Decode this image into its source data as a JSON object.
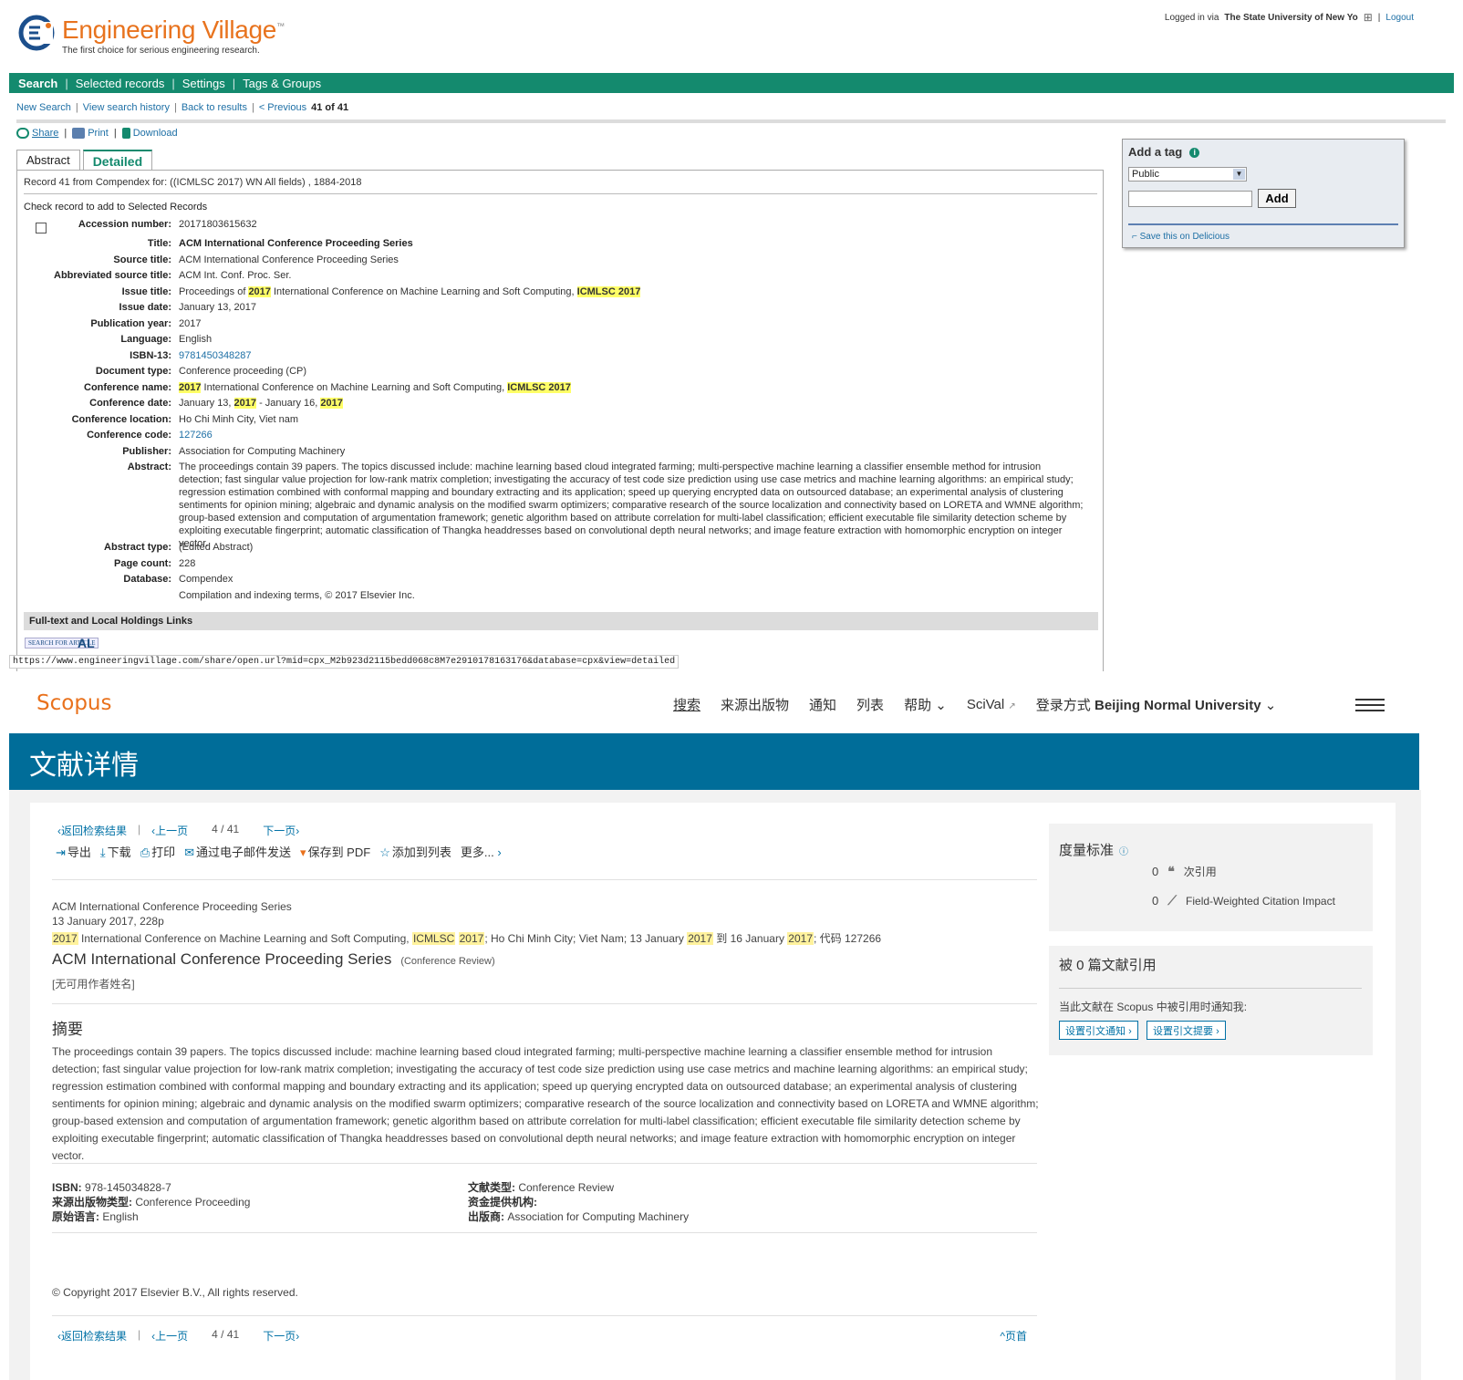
{
  "ev": {
    "logo_name": "Engineering Village",
    "logo_tm": "™",
    "tagline": "The first choice for serious engineering research.",
    "login_prefix": "Logged in via",
    "login_institution": "The State University of New Yo",
    "logout": "Logout",
    "nav": [
      "Search",
      "Selected records",
      "Settings",
      "Tags & Groups"
    ],
    "subnav": {
      "new_search": "New Search",
      "history": "View search history",
      "back": "Back to results",
      "previous": "< Previous",
      "pos": "41 of 41"
    },
    "tools": {
      "share": "Share",
      "print": "Print",
      "download": "Download"
    },
    "tabs": [
      "Abstract",
      "Detailed"
    ],
    "record_line": "Record 41 from Compendex for: ((ICMLSC 2017) WN All fields) , 1884-2018",
    "check_label": "Check record to add to Selected Records",
    "fields": {
      "accession": {
        "k": "Accession number:",
        "v": "20171803615632"
      },
      "title": {
        "k": "Title:",
        "v": "ACM International Conference Proceeding Series"
      },
      "source": {
        "k": "Source title:",
        "v": "ACM International Conference Proceeding Series"
      },
      "abbr": {
        "k": "Abbreviated source title:",
        "v": "ACM Int. Conf. Proc. Ser."
      },
      "issue_title": {
        "k": "Issue title:",
        "a": "Proceedings of ",
        "b": "2017",
        "c": " International Conference on Machine Learning and Soft Computing, ",
        "d": "ICMLSC 2017"
      },
      "issue_date": {
        "k": "Issue date:",
        "v": "January 13, 2017"
      },
      "pub_year": {
        "k": "Publication year:",
        "v": "2017"
      },
      "language": {
        "k": "Language:",
        "v": "English"
      },
      "isbn": {
        "k": "ISBN-13:",
        "v": "9781450348287"
      },
      "doc_type": {
        "k": "Document type:",
        "v": "Conference proceeding (CP)"
      },
      "conf_name": {
        "k": "Conference name:",
        "a": "2017",
        "b": " International Conference on Machine Learning and Soft Computing, ",
        "c": "ICMLSC 2017"
      },
      "conf_date": {
        "k": "Conference date:",
        "a": "January 13, ",
        "b": "2017",
        "c": " - January 16, ",
        "d": "2017"
      },
      "conf_loc": {
        "k": "Conference location:",
        "v": "Ho Chi Minh City, Viet nam"
      },
      "conf_code": {
        "k": "Conference code:",
        "v": "127266"
      },
      "publisher": {
        "k": "Publisher:",
        "v": "Association for Computing Machinery"
      },
      "abstract": {
        "k": "Abstract:",
        "v": "The proceedings contain 39 papers. The topics discussed include: machine learning based cloud integrated farming; multi-perspective machine learning a classifier ensemble method for intrusion detection; fast singular value projection for low-rank matrix completion; investigating the accuracy of test code size prediction using use case metrics and machine learning algorithms: an empirical study; regression estimation combined with conformal mapping and boundary extracting and its application; speed up querying encrypted data on outsourced database; an experimental analysis of clustering sentiments for opinion mining; algebraic and dynamic analysis on the modified swarm optimizers; comparative research of the source localization and connectivity based on LORETA and WMNE algorithm; group-based extension and computation of argumentation framework; genetic algorithm based on attribute correlation for multi-label classification; efficient executable file similarity detection scheme by exploiting executable fingerprint; automatic classification of Thangka headdresses based on convolutional depth neural networks; and image feature extraction with homomorphic encryption on integer vector."
      },
      "abs_type": {
        "k": "Abstract type:",
        "v": "(Edited Abstract)"
      },
      "page_count": {
        "k": "Page count:",
        "v": "228"
      },
      "database": {
        "k": "Database:",
        "v": "Compendex"
      },
      "compilation": "Compilation and indexing terms, © 2017 Elsevier Inc."
    },
    "fulltext_heading": "Full-text and Local Holdings Links",
    "sfa_label": "SEARCH FOR ARTICLE",
    "al_label": "AL",
    "status_url": "https://www.engineeringvillage.com/share/open.url?mid=cpx_M2b923d2115bedd068c8M7e2910178163176&database=cpx&view=detailed",
    "tagbox": {
      "title": "Add a tag",
      "select_value": "Public",
      "add_button": "Add",
      "delicious": "Save this on Delicious"
    }
  },
  "sc": {
    "logo": "Scopus",
    "nav": {
      "search": "搜索",
      "sources": "来源出版物",
      "alerts": "通知",
      "lists": "列表",
      "help": "帮助",
      "scival": "SciVal",
      "login_prefix": "登录方式",
      "institution": "Beijing Normal University"
    },
    "banner": "文献详情",
    "pager": {
      "back": "返回检索结果",
      "prev": "上一页",
      "count": "4 / 41",
      "next": "下一页"
    },
    "actions": [
      "导出",
      "下载",
      "打印",
      "通过电子邮件发送",
      "保存到 PDF",
      "添加到列表",
      "更多..."
    ],
    "source_line1": "ACM International Conference Proceeding Series",
    "source_line2": "13 January 2017, 228p",
    "conf_parts": {
      "y1": "2017",
      "t1": " International Conference on Machine Learning and Soft Computing, ",
      "icml": "ICMLSC",
      "y2": "2017",
      "t2": "; Ho Chi Minh City; Viet Nam; 13 January ",
      "y3": "2017",
      "t3": " 到 16 January ",
      "y4": "2017",
      "t4": "; 代码 127266"
    },
    "title": "ACM International Conference Proceeding Series",
    "title_type": "(Conference Review)",
    "no_author": "[无可用作者姓名]",
    "abstract_heading": "摘要",
    "abstract": "The proceedings contain 39 papers. The topics discussed include: machine learning based cloud integrated farming; multi-perspective machine learning a classifier ensemble method for intrusion detection; fast singular value projection for low-rank matrix completion; investigating the accuracy of test code size prediction using use case metrics and machine learning algorithms: an empirical study; regression estimation combined with conformal mapping and boundary extracting and its application; speed up querying encrypted data on outsourced database; an experimental analysis of clustering sentiments for opinion mining; algebraic and dynamic analysis on the modified swarm optimizers; comparative research of the source localization and connectivity based on LORETA and WMNE algorithm; group-based extension and computation of argumentation framework; genetic algorithm based on attribute correlation for multi-label classification; efficient executable file similarity detection scheme by exploiting executable fingerprint; automatic classification of Thangka headdresses based on convolutional depth neural networks; and image feature extraction with homomorphic encryption on integer vector.",
    "meta": {
      "isbn_k": "ISBN:",
      "isbn_v": "978-145034828-7",
      "srctype_k": "来源出版物类型:",
      "srctype_v": "Conference Proceeding",
      "lang_k": "原始语言:",
      "lang_v": "English",
      "doctype_k": "文献类型:",
      "doctype_v": "Conference Review",
      "funder_k": "资金提供机构:",
      "funder_v": "",
      "publisher_k": "出版商:",
      "publisher_v": "Association for Computing Machinery"
    },
    "copyright": "© Copyright 2017 Elsevier B.V., All rights reserved.",
    "back_top": "页首",
    "metrics": {
      "title": "度量标准",
      "citations_value": "0",
      "citations_label": "次引用",
      "fwci_value": "0",
      "fwci_label": "Field-Weighted Citation Impact"
    },
    "cited_by": {
      "title": "被 0 篇文献引用",
      "notify": "当此文献在 Scopus 中被引用时通知我:",
      "alert_button": "设置引文通知",
      "feed_button": "设置引文提要"
    }
  }
}
